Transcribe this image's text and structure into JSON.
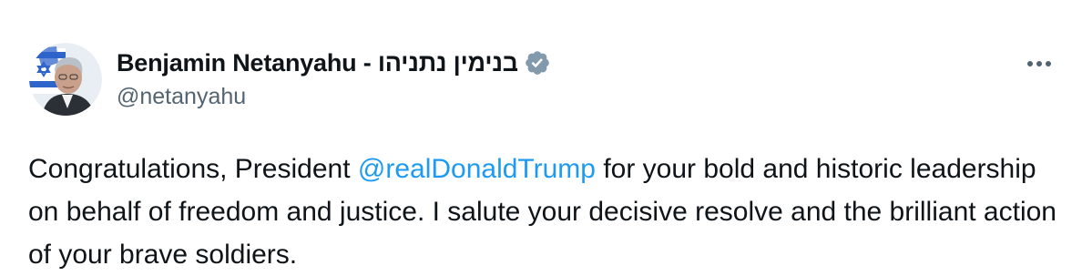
{
  "tweet": {
    "author": {
      "display_name": "Benjamin Netanyahu - בנימין נתניהו",
      "handle": "@netanyahu",
      "verified": true,
      "avatar_alt": "Profile photo"
    },
    "text_before": "Congratulations, President ",
    "mention": "@realDonaldTrump",
    "text_after": " for your bold and historic leadership on behalf of freedom and justice. I salute your decisive resolve and the brilliant action of your brave soldiers."
  },
  "icons": {
    "verified": "verified-badge-icon",
    "more": "more-options-icon"
  },
  "colors": {
    "text": "#0f1419",
    "secondary": "#536471",
    "link": "#1d9bf0",
    "verified_badge": "#829aab"
  }
}
